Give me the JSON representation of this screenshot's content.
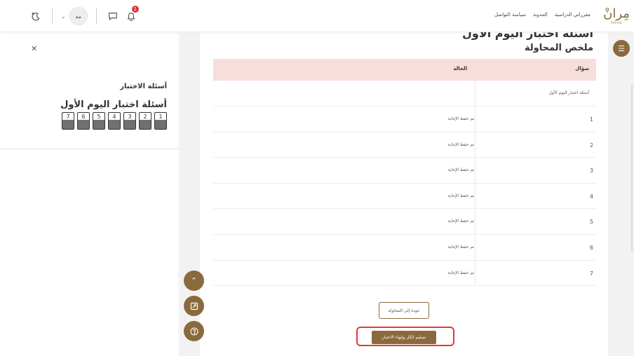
{
  "navbar": {
    "logo_text": "مِرانْ",
    "logo_sub": "MIRAN",
    "links": [
      "مقرراتي الدراسية",
      "المدونة",
      "سياسة التواصل"
    ],
    "user_initials": "مه",
    "notification_count": "1",
    "icons": [
      "bell-icon",
      "chat-icon",
      "chevron-down-icon",
      "theme-toggle-icon"
    ]
  },
  "drawer": {
    "title": "أسئلة الاختبار",
    "section_name": "أسئلة اختبار اليوم الأول",
    "question_buttons": [
      "1",
      "2",
      "3",
      "4",
      "5",
      "6",
      "7"
    ]
  },
  "main": {
    "clipped_heading": "أسئلة اختبار اليوم الأول",
    "summary_title": "ملخص المحاولة",
    "table": {
      "col_question": "سؤال",
      "col_status": "الحالة",
      "section_label": "أسئلة اختبار اليوم الأول",
      "rows": [
        {
          "q": "1",
          "status": "تم حفظ الإجابة"
        },
        {
          "q": "2",
          "status": "تم حفظ الإجابة"
        },
        {
          "q": "3",
          "status": "تم حفظ الإجابة"
        },
        {
          "q": "4",
          "status": "تم حفظ الإجابة"
        },
        {
          "q": "5",
          "status": "تم حفظ الإجابة"
        },
        {
          "q": "6",
          "status": "تم حفظ الإجابة"
        },
        {
          "q": "7",
          "status": "تم حفظ الإجابة"
        }
      ]
    },
    "return_button": "عودة إلى المحاولة",
    "submit_button": "تسليم الكل وإنهاء الاختبار"
  },
  "colors": {
    "brand": "#8a6a3d",
    "table_header_bg": "#f7dddb",
    "highlight": "#e53935",
    "badge": "#d9363e"
  }
}
